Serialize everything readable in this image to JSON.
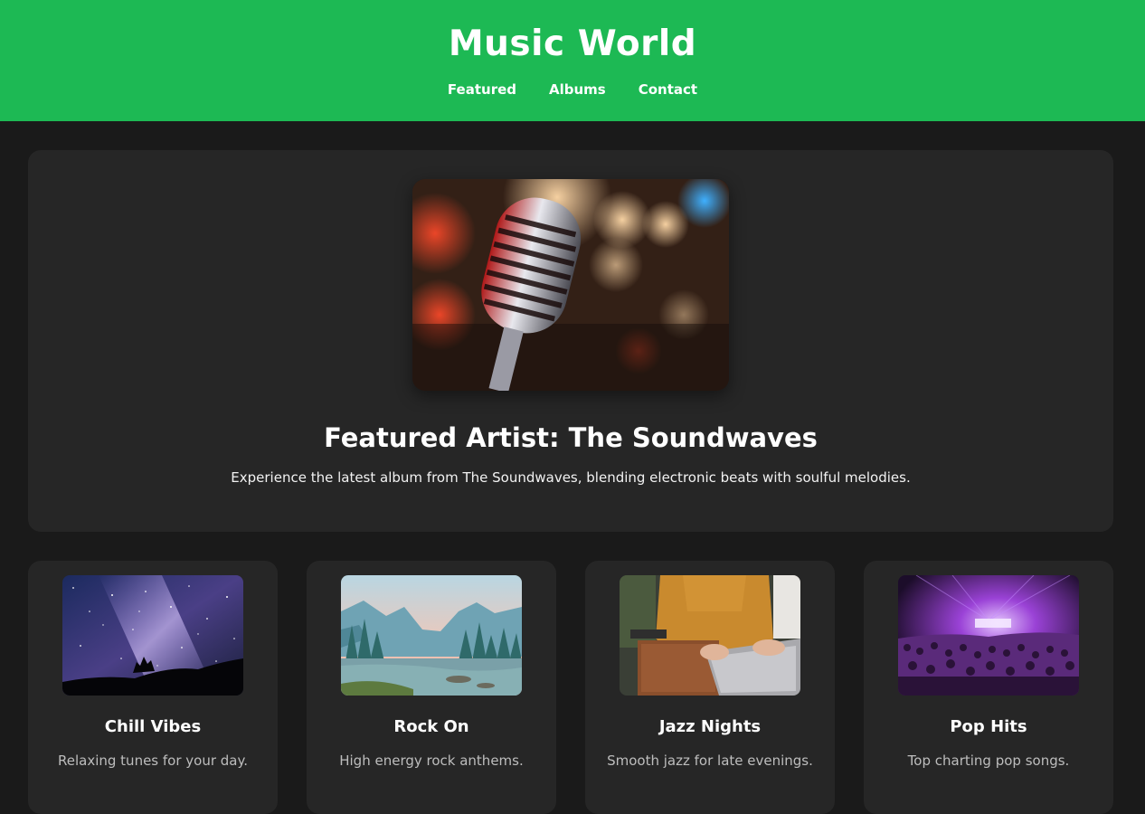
{
  "header": {
    "title": "Music World",
    "nav": [
      "Featured",
      "Albums",
      "Contact"
    ]
  },
  "hero": {
    "image_icon": "microphone-image",
    "heading": "Featured Artist: The Soundwaves",
    "description": "Experience the latest album from The Soundwaves, blending electronic beats with soulful melodies."
  },
  "cards": [
    {
      "title": "Chill Vibes",
      "description": "Relaxing tunes for your day.",
      "image_icon": "milky-way-image"
    },
    {
      "title": "Rock On",
      "description": "High energy rock anthems.",
      "image_icon": "mountain-lake-image"
    },
    {
      "title": "Jazz Nights",
      "description": "Smooth jazz for late evenings.",
      "image_icon": "laptop-hands-image"
    },
    {
      "title": "Pop Hits",
      "description": "Top charting pop songs.",
      "image_icon": "concert-crowd-image"
    }
  ],
  "colors": {
    "brand": "#1db954",
    "background": "#1a1a1a",
    "panel": "#262626"
  }
}
